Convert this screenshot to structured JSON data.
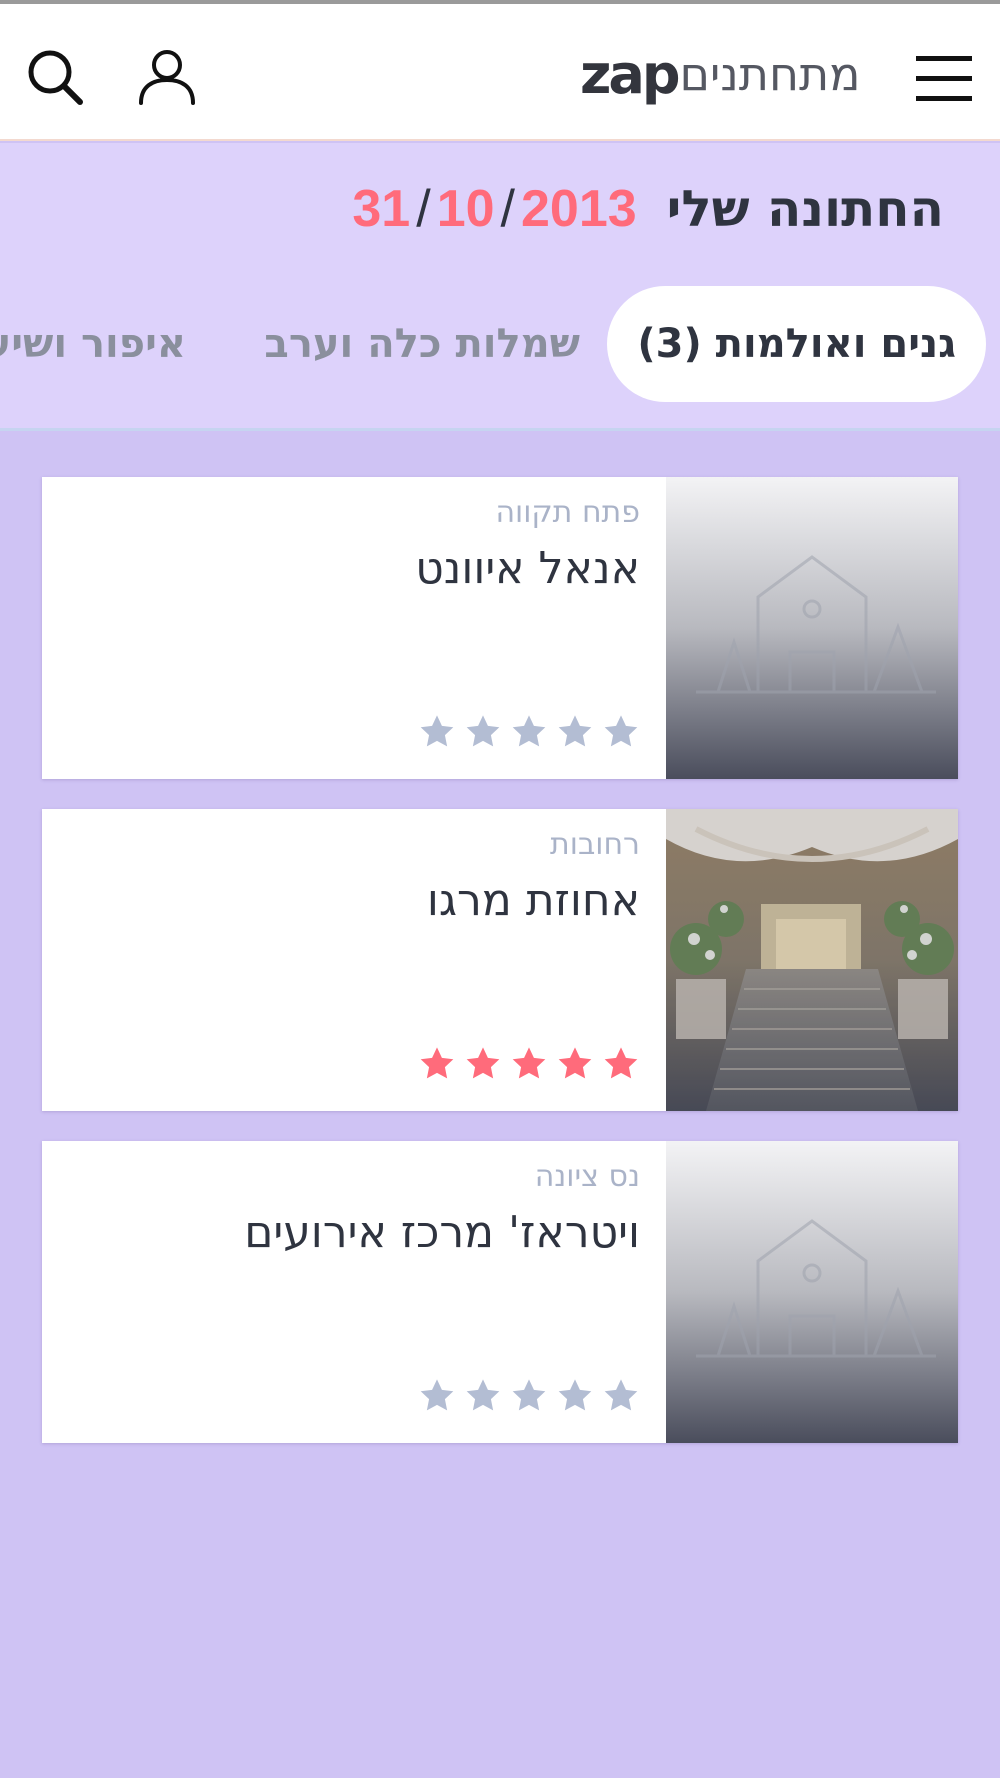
{
  "header": {
    "logo_text": "zap",
    "brand_text": "מתחתנים",
    "menu_icon": "hamburger-menu-icon",
    "user_icon": "user-icon",
    "search_icon": "search-icon"
  },
  "wedding": {
    "title": "החתונה שלי",
    "date_day": "31",
    "date_month": "10",
    "date_year": "2013",
    "date_separator": "/",
    "date_color": "#ff6b7b"
  },
  "tabs": [
    {
      "label": "גנים ואולמות (3)",
      "active": true
    },
    {
      "label": "שמלות כלה וערב",
      "active": false
    },
    {
      "label": "איפור ושיער",
      "active": false
    }
  ],
  "venues": [
    {
      "city": "פתח תקווה",
      "name": "אנאל איוונט",
      "rating": 0,
      "image": "placeholder-venue-icon"
    },
    {
      "city": "רחובות",
      "name": "אחוזת מרגו",
      "rating": 5,
      "image": "venue-photo"
    },
    {
      "city": "נס ציונה",
      "name": "ויטראז' מרכז אירועים",
      "rating": 0,
      "image": "placeholder-venue-icon"
    }
  ],
  "colors": {
    "accent_red": "#ff6b7b",
    "star_empty": "#b3bdd3",
    "background": "#cfc3f4",
    "band": "#ddd2fb"
  }
}
